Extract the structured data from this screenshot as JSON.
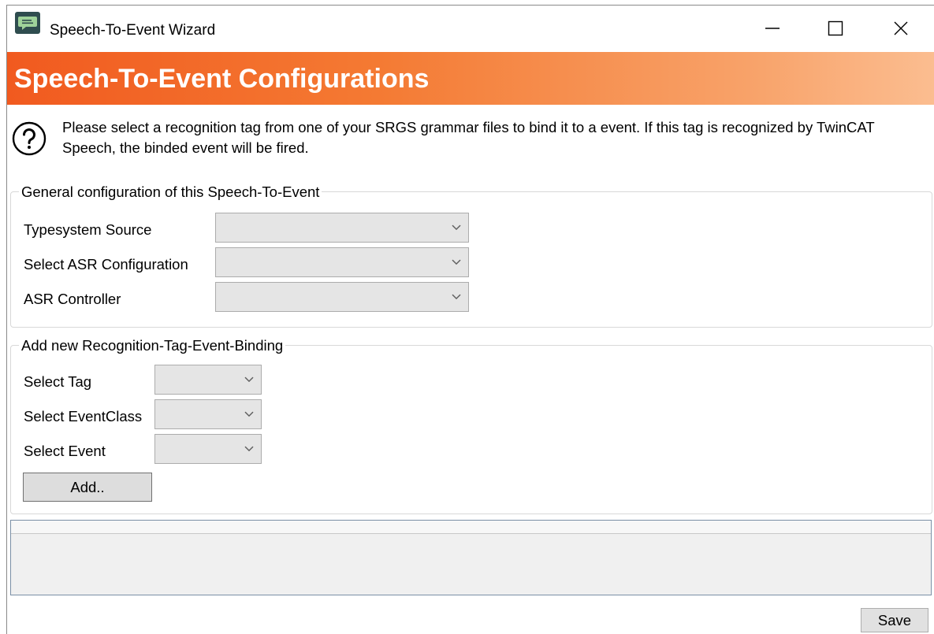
{
  "window": {
    "title": "Speech-To-Event Wizard",
    "icons": {
      "app": "speech-bubble-icon",
      "minimize": "minimize-icon",
      "maximize": "maximize-icon",
      "close": "close-icon"
    }
  },
  "header": {
    "title": "Speech-To-Event Configurations",
    "colors": {
      "start": "#f15a1f",
      "end": "#fbbd90",
      "text": "#ffffff"
    }
  },
  "help": {
    "icon": "question-icon",
    "text": "Please select a recognition tag from one of your SRGS grammar files to bind it to a event. If this tag is recognized by TwinCAT Speech, the binded event will be fired."
  },
  "general": {
    "legend": "General configuration of this Speech-To-Event",
    "fields": [
      {
        "label": "Typesystem Source",
        "value": ""
      },
      {
        "label": "Select ASR Configuration",
        "value": ""
      },
      {
        "label": "ASR Controller",
        "value": ""
      }
    ]
  },
  "binding": {
    "legend": "Add new Recognition-Tag-Event-Binding",
    "fields": [
      {
        "label": "Select Tag",
        "value": ""
      },
      {
        "label": "Select EventClass",
        "value": ""
      },
      {
        "label": "Select Event",
        "value": ""
      }
    ],
    "add_label": "Add.."
  },
  "footer": {
    "save_label": "Save"
  }
}
